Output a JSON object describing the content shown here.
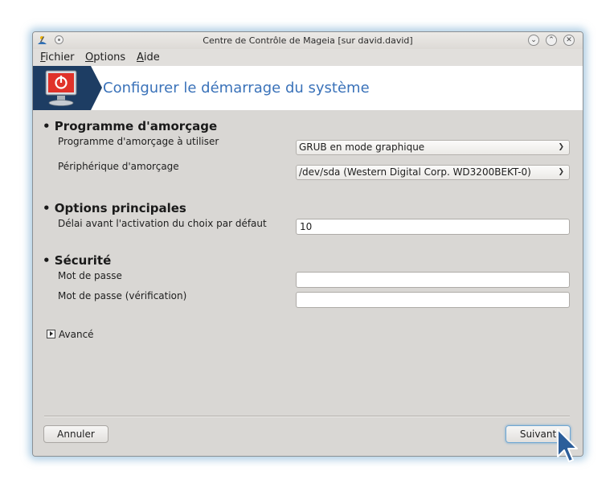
{
  "window": {
    "title": "Centre de Contrôle de Mageia  [sur david.david]",
    "buttons": [
      "minimize-icon",
      "maximize-icon",
      "close-icon"
    ]
  },
  "menu": {
    "fichier": {
      "first": "F",
      "rest": "ichier"
    },
    "options": {
      "first": "O",
      "rest": "ptions"
    },
    "aide": {
      "first": "A",
      "rest": "ide"
    }
  },
  "banner": {
    "title": "Configurer le démarrage du système",
    "icon": "power-monitor-icon"
  },
  "sections": {
    "bootloader": {
      "title": "• Programme d'amorçage",
      "program_label": "Programme d'amorçage à utiliser",
      "program_value": "GRUB en mode graphique",
      "device_label": "Périphérique d'amorçage",
      "device_value": "/dev/sda (Western Digital Corp. WD3200BEKT-0)"
    },
    "main_options": {
      "title": "• Options principales",
      "delay_label": "Délai avant l'activation du choix par défaut",
      "delay_value": "10"
    },
    "security": {
      "title": "• Sécurité",
      "password_label": "Mot de passe",
      "password_value": "",
      "password_verify_label": "Mot de passe (vérification)",
      "password_verify_value": ""
    }
  },
  "advanced": {
    "label": "Avancé"
  },
  "buttons": {
    "cancel": "Annuler",
    "next": "Suivant"
  },
  "colors": {
    "banner_title": "#3a72b9",
    "banner_bg": "#1d3d63",
    "window_bg": "#d9d7d4",
    "glow": "#6ea5cd"
  }
}
